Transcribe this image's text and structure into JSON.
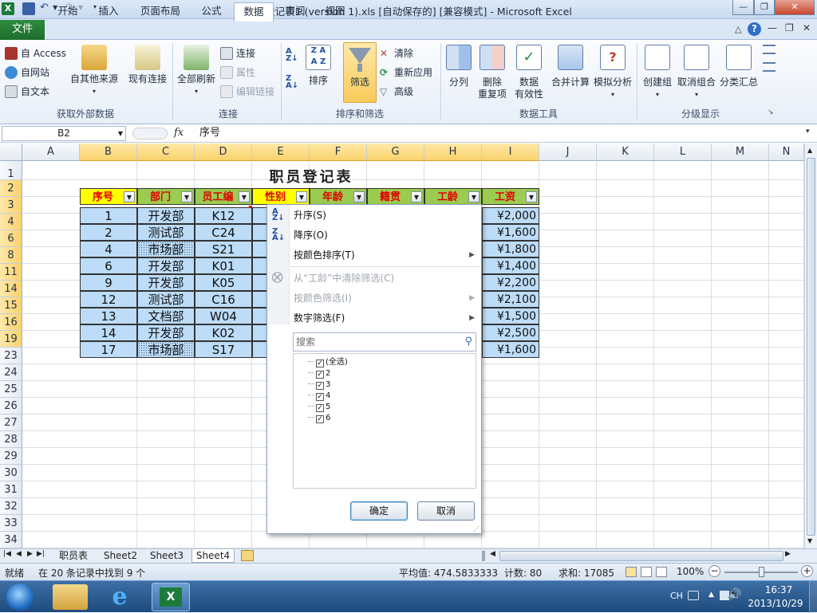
{
  "window": {
    "title": "职员登记表1 (version 1).xls [自动保存的] [兼容模式] - Microsoft Excel",
    "app_icon": "X"
  },
  "ribbon_tabs": {
    "file": "文件",
    "items": [
      "开始",
      "插入",
      "页面布局",
      "公式",
      "数据",
      "审阅",
      "视图"
    ],
    "active": "数据"
  },
  "ribbon": {
    "external": {
      "access": "自 Access",
      "web": "自网站",
      "text": "自文本",
      "other": "自其他来源",
      "existing": "现有连接",
      "group": "获取外部数据"
    },
    "connections": {
      "refresh_all": "全部刷新",
      "connections": "连接",
      "properties": "属性",
      "edit_links": "编辑链接",
      "group": "连接"
    },
    "sortfilter": {
      "sort": "排序",
      "filter": "筛选",
      "clear": "清除",
      "reapply": "重新应用",
      "advanced": "高级",
      "group": "排序和筛选"
    },
    "datatools": {
      "split": "分列",
      "remove_dup_1": "删除",
      "remove_dup_2": "重复项",
      "validation_1": "数据",
      "validation_2": "有效性",
      "consolidate": "合并计算",
      "whatif": "模拟分析",
      "group": "数据工具"
    },
    "outline": {
      "group_btn": "创建组",
      "ungroup": "取消组合",
      "subtotal": "分类汇总",
      "group": "分级显示"
    }
  },
  "formula_bar": {
    "name_box": "B2",
    "fx": "fx",
    "content": "序号"
  },
  "columns": [
    "A",
    "B",
    "C",
    "D",
    "E",
    "F",
    "G",
    "H",
    "I",
    "J",
    "K",
    "L",
    "M",
    "N"
  ],
  "selected_columns": [
    "B",
    "C",
    "D",
    "E",
    "F",
    "G",
    "H",
    "I"
  ],
  "rows": [
    "1",
    "2",
    "3",
    "4",
    "6",
    "8",
    "11",
    "14",
    "15",
    "16",
    "19",
    "23",
    "24",
    "25",
    "26",
    "27",
    "28",
    "29",
    "30",
    "31",
    "32",
    "33",
    "34"
  ],
  "sheet": {
    "title": "职员登记表",
    "headers": [
      "序号",
      "部门",
      "员工编",
      "性别",
      "年龄",
      "籍贯",
      "工龄",
      "工资"
    ],
    "records": [
      {
        "no": "1",
        "dept": "开发部",
        "id": "K12",
        "salary": "¥2,000"
      },
      {
        "no": "2",
        "dept": "测试部",
        "id": "C24",
        "salary": "¥1,600"
      },
      {
        "no": "4",
        "dept": "市场部",
        "id": "S21",
        "salary": "¥1,800"
      },
      {
        "no": "6",
        "dept": "开发部",
        "id": "K01",
        "salary": "¥1,400"
      },
      {
        "no": "9",
        "dept": "开发部",
        "id": "K05",
        "salary": "¥2,200"
      },
      {
        "no": "12",
        "dept": "测试部",
        "id": "C16",
        "salary": "¥2,100"
      },
      {
        "no": "13",
        "dept": "文档部",
        "id": "W04",
        "salary": "¥1,500"
      },
      {
        "no": "14",
        "dept": "开发部",
        "id": "K02",
        "salary": "¥2,500"
      },
      {
        "no": "17",
        "dept": "市场部",
        "id": "S17",
        "salary": "¥1,600"
      }
    ]
  },
  "filter_menu": {
    "sort_asc": "升序(S)",
    "sort_desc": "降序(O)",
    "sort_by_color": "按颜色排序(T)",
    "clear_filter": "从“工龄”中清除筛选(C)",
    "filter_by_color": "按颜色筛选(I)",
    "number_filter": "数字筛选(F)",
    "search_placeholder": "搜索",
    "values": [
      "(全选)",
      "2",
      "3",
      "4",
      "5",
      "6"
    ],
    "ok": "确定",
    "cancel": "取消"
  },
  "sheet_tabs": [
    "职员表",
    "Sheet2",
    "Sheet3",
    "Sheet4"
  ],
  "active_sheet": "Sheet4",
  "status": {
    "ready": "就绪",
    "found": "在 20 条记录中找到 9 个",
    "average": "平均值: 474.5833333",
    "count": "计数: 80",
    "sum": "求和: 17085",
    "zoom": "100%"
  },
  "taskbar": {
    "lang": "CH",
    "time": "16:37",
    "date": "2013/10/29"
  },
  "colors": {
    "header_green": "#9bcb4f",
    "header_yellow": "#ffff00",
    "header_text": "#e00000",
    "data_blue": "#bcdcf7",
    "excel_green": "#1d6d2c"
  }
}
